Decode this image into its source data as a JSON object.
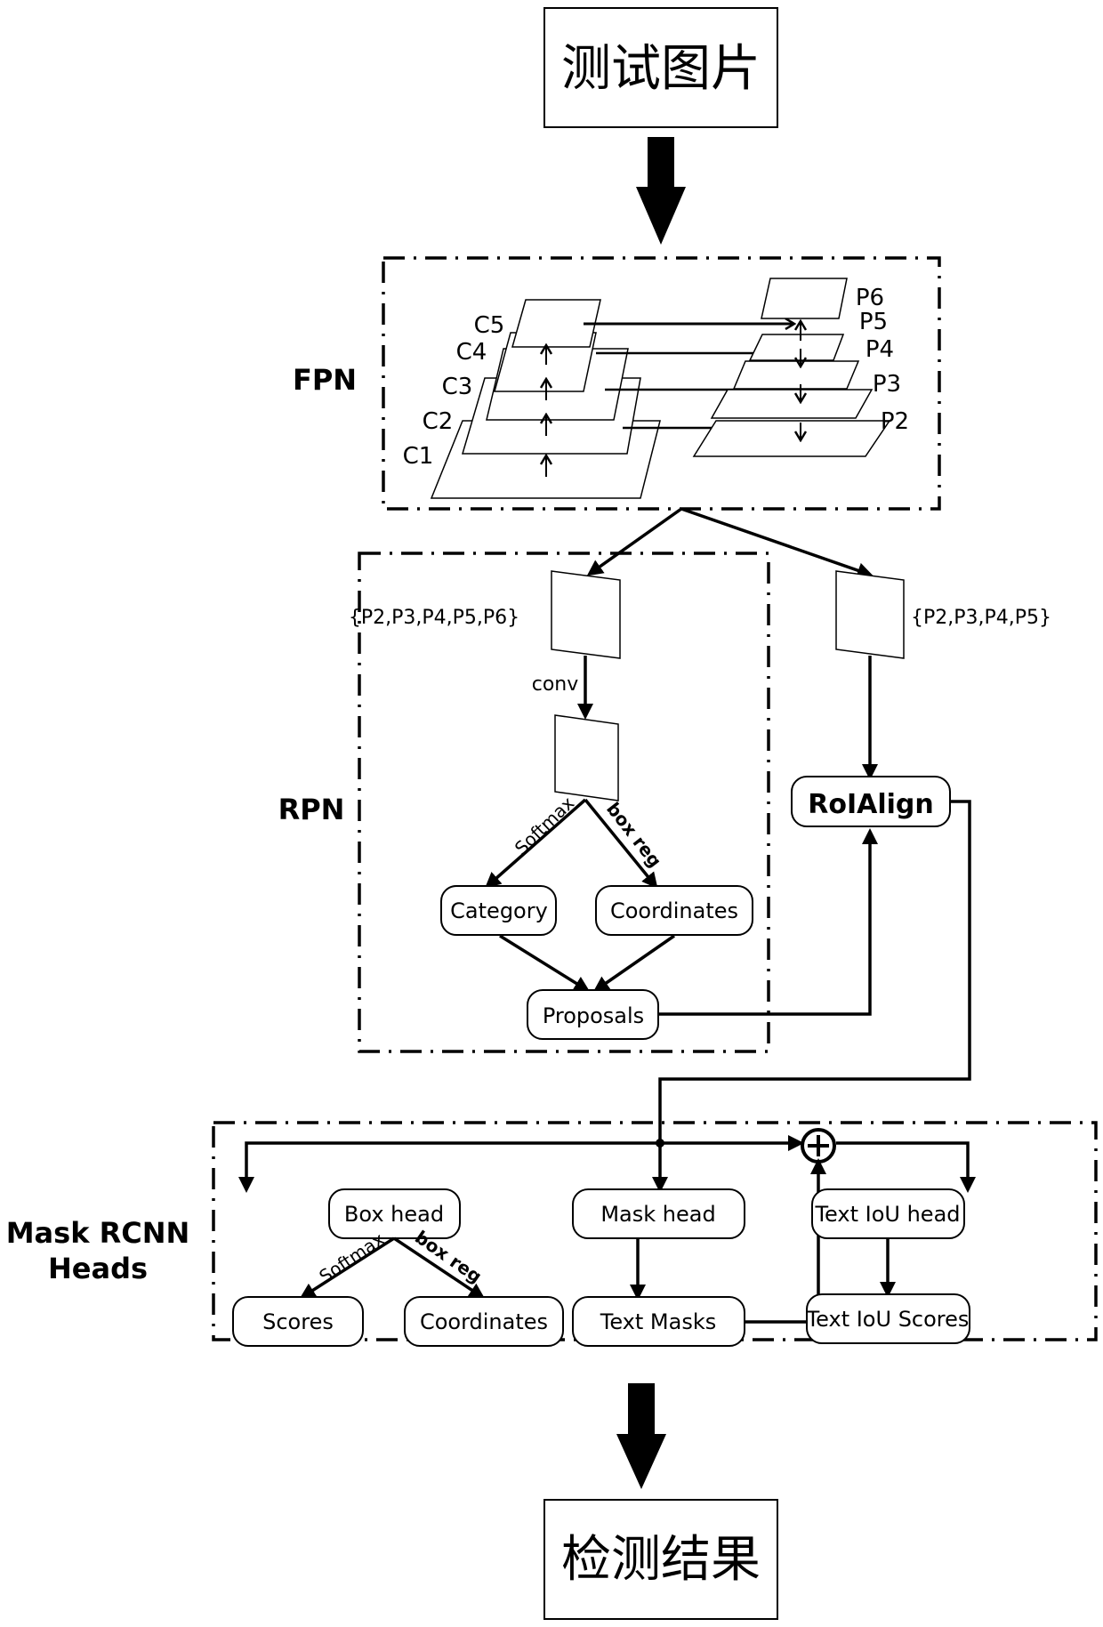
{
  "diagram": {
    "input_box": {
      "label": "测试图片"
    },
    "output_box": {
      "label": "检测结果"
    },
    "sections": {
      "fpn": "FPN",
      "rpn": "RPN",
      "heads_line1": "Mask RCNN",
      "heads_line2": "Heads"
    },
    "fpn": {
      "bottom_up": [
        "C1",
        "C2",
        "C3",
        "C4",
        "C5"
      ],
      "top_down": [
        "P2",
        "P3",
        "P4",
        "P5",
        "P6"
      ]
    },
    "rpn": {
      "feature_label": "{P2,P3,P4,P5,P6}",
      "conv_label": "conv",
      "softmax_label": "Softmax",
      "boxreg_label": "box reg",
      "category": "Category",
      "coordinates": "Coordinates",
      "proposals": "Proposals"
    },
    "roi": {
      "feature_label": "{P2,P3,P4,P5}",
      "roialign": "RoIAlign"
    },
    "heads": {
      "box_head": "Box head",
      "mask_head": "Mask head",
      "text_iou_head": "Text IoU head",
      "softmax_label": "Softmax",
      "boxreg_label": "box reg",
      "scores": "Scores",
      "coordinates": "Coordinates",
      "text_masks": "Text Masks",
      "text_iou_scores": "Text IoU Scores",
      "sum_symbol": "+"
    }
  }
}
